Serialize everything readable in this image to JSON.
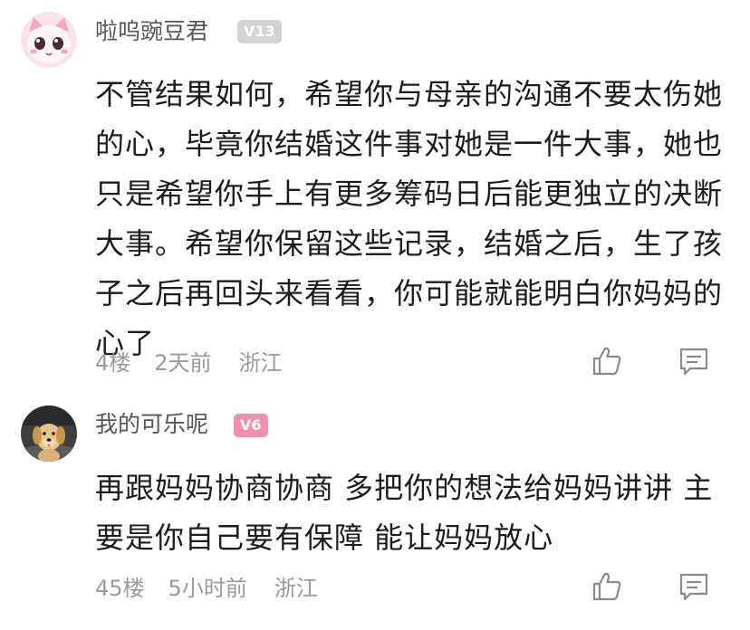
{
  "comments": [
    {
      "username": "啦呜豌豆君",
      "level": "V13",
      "content_lines": [
        "不管结果如何，希望你与母亲的沟通不要太伤她",
        "的心，毕竟你结婚这件事对她是一件大事，她也",
        "只是希望你手上有更多筹码日后能更独立的决断",
        "大事。希望你保留这些记录，结婚之后，生了孩",
        "子之后再回头来看看，你可能就能明白你妈妈的",
        "心了"
      ],
      "floor": "4楼",
      "time": "2天前",
      "location": "浙江",
      "avatar_icon": "pink-cartoon-avatar",
      "badge_color": "#d4d4d4"
    },
    {
      "username": "我的可乐呢",
      "level": "V6",
      "content_lines": [
        "再跟妈妈协商协商 多把你的想法给妈妈讲讲 主",
        "要是你自己要有保障 能让妈妈放心"
      ],
      "floor": "45楼",
      "time": "5小时前",
      "location": "浙江",
      "avatar_icon": "puppy-photo-avatar",
      "badge_color": "#f58fb0"
    }
  ]
}
